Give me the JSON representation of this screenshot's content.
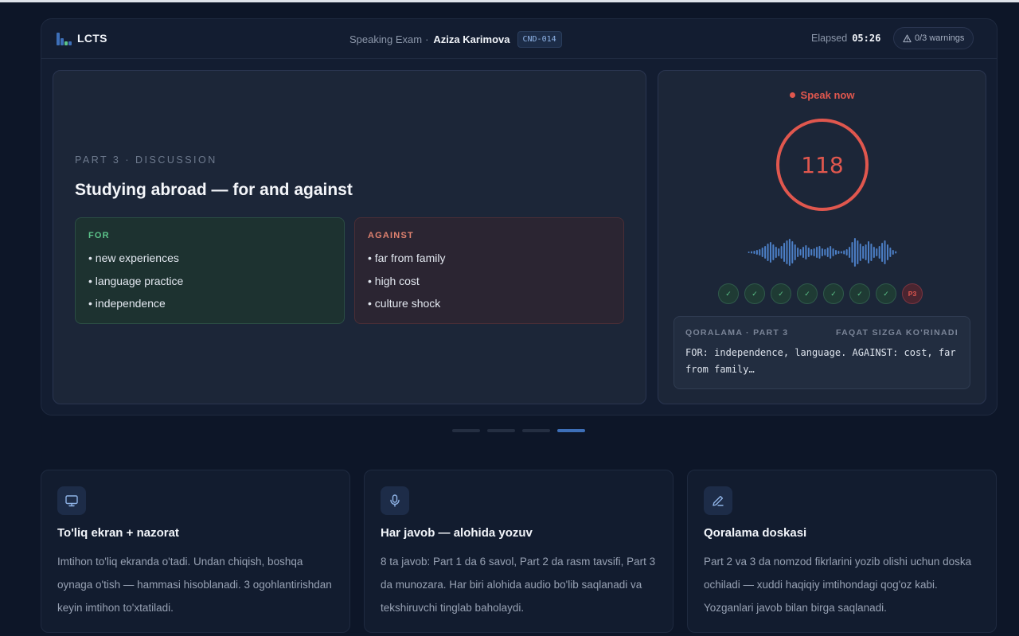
{
  "header": {
    "brand": "LCTS",
    "exam_label": "Speaking Exam",
    "separator": "·",
    "candidate_name": "Aziza Karimova",
    "candidate_id": "CND-014",
    "elapsed_label": "Elapsed",
    "elapsed_value": "05:26",
    "warnings_label": "0/3 warnings",
    "warnings_icon": "warning-triangle-icon"
  },
  "question": {
    "part_label": "PART 3 · DISCUSSION",
    "topic": "Studying abroad — for and against",
    "for": {
      "title": "FOR",
      "items": [
        "• new experiences",
        "• language practice",
        "• independence"
      ]
    },
    "against": {
      "title": "AGAINST",
      "items": [
        "• far from family",
        "• high cost",
        "• culture shock"
      ]
    }
  },
  "recorder": {
    "status": "Speak now",
    "seconds_left": "118",
    "progress": [
      "✓",
      "✓",
      "✓",
      "✓",
      "✓",
      "✓",
      "✓",
      "P3"
    ],
    "draft": {
      "title": "QORALAMA · PART 3",
      "visibility": "FAQAT SIZGA KO'RINADI",
      "text": "FOR: independence, language. AGAINST: cost, far from family…"
    }
  },
  "carousel": {
    "count": 4,
    "active_index": 3
  },
  "features": [
    {
      "icon": "monitor-icon",
      "title": "To'liq ekran + nazorat",
      "description": "Imtihon to'liq ekranda o'tadi. Undan chiqish, boshqa oynaga o'tish — hammasi hisoblanadi. 3 ogohlantirishdan keyin imtihon to'xtatiladi."
    },
    {
      "icon": "microphone-icon",
      "title": "Har javob — alohida yozuv",
      "description": "8 ta javob: Part 1 da 6 savol, Part 2 da rasm tavsifi, Part 3 da munozara. Har biri alohida audio bo'lib saqlanadi va tekshiruvchi tinglab baholaydi."
    },
    {
      "icon": "pencil-icon",
      "title": "Qoralama doskasi",
      "description": "Part 2 va 3 da nomzod fikrlarini yozib olishi uchun doska ochiladi — xuddi haqiqiy imtihondagi qog'oz kabi. Yozganlari javob bilan birga saqlanadi."
    }
  ],
  "colors": {
    "background": "#0d1628",
    "accent_red": "#e0574e",
    "accent_green": "#5cc48a",
    "accent_blue": "#3d6fb8"
  }
}
